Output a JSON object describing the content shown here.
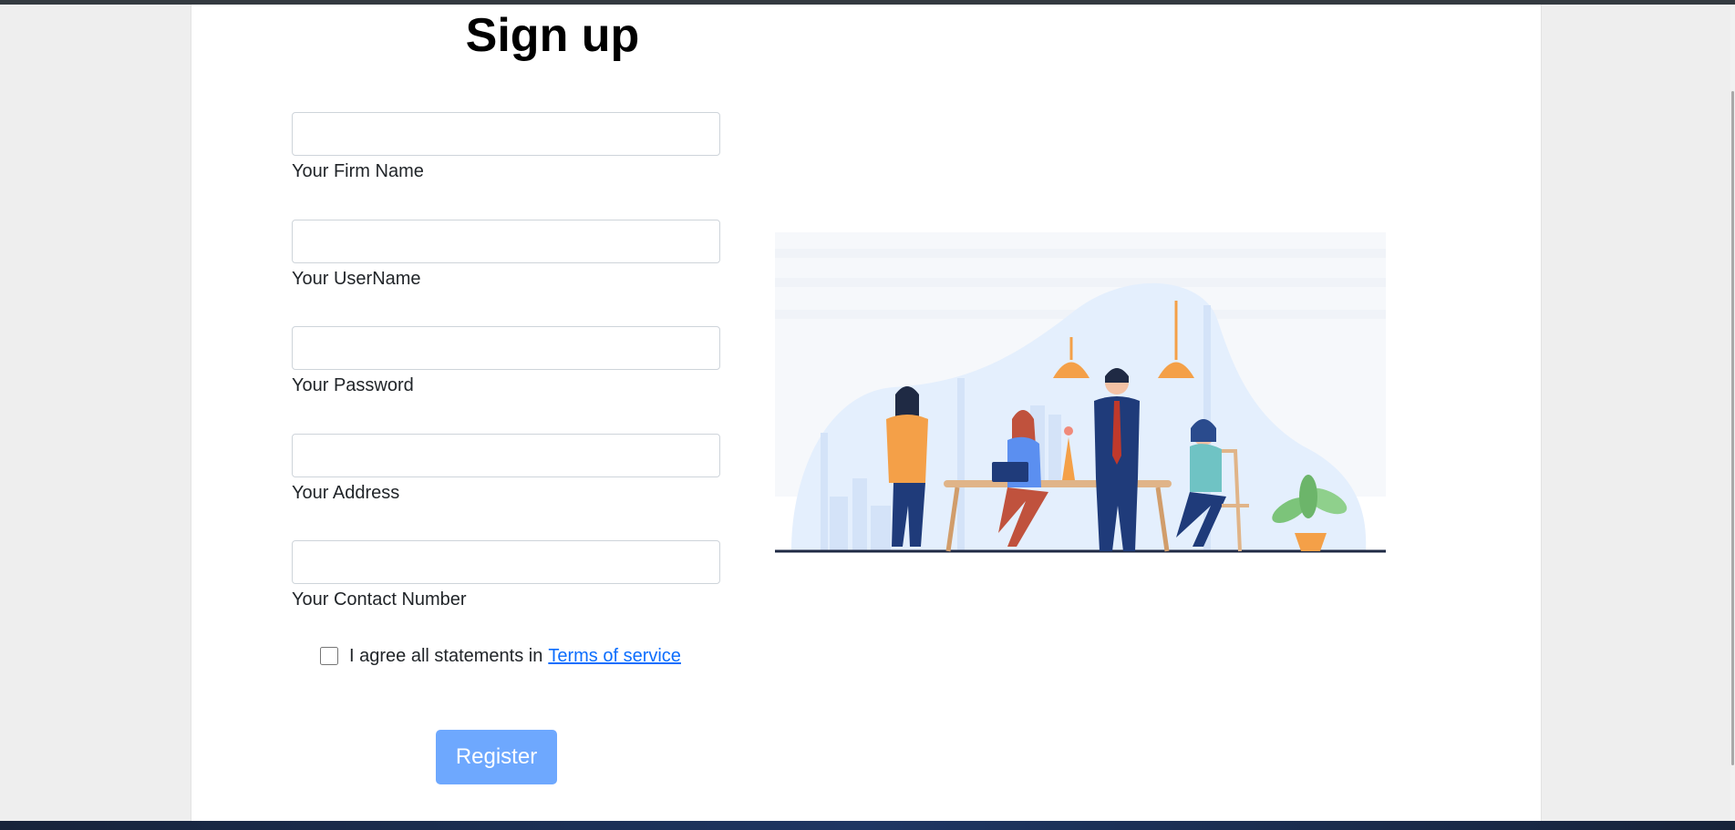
{
  "form": {
    "title": "Sign up",
    "fields": [
      {
        "label": "Your Firm Name",
        "value": ""
      },
      {
        "label": "Your UserName",
        "value": ""
      },
      {
        "label": "Your Password",
        "value": ""
      },
      {
        "label": "Your Address",
        "value": ""
      },
      {
        "label": "Your Contact Number",
        "value": ""
      }
    ],
    "agree_text": "I agree all statements in",
    "terms_link": "Terms of service",
    "register_label": "Register"
  },
  "colors": {
    "button": "#6ea8fe",
    "link": "#0d6efd",
    "accent_orange": "#f4a048",
    "navy": "#1f3b7a"
  }
}
